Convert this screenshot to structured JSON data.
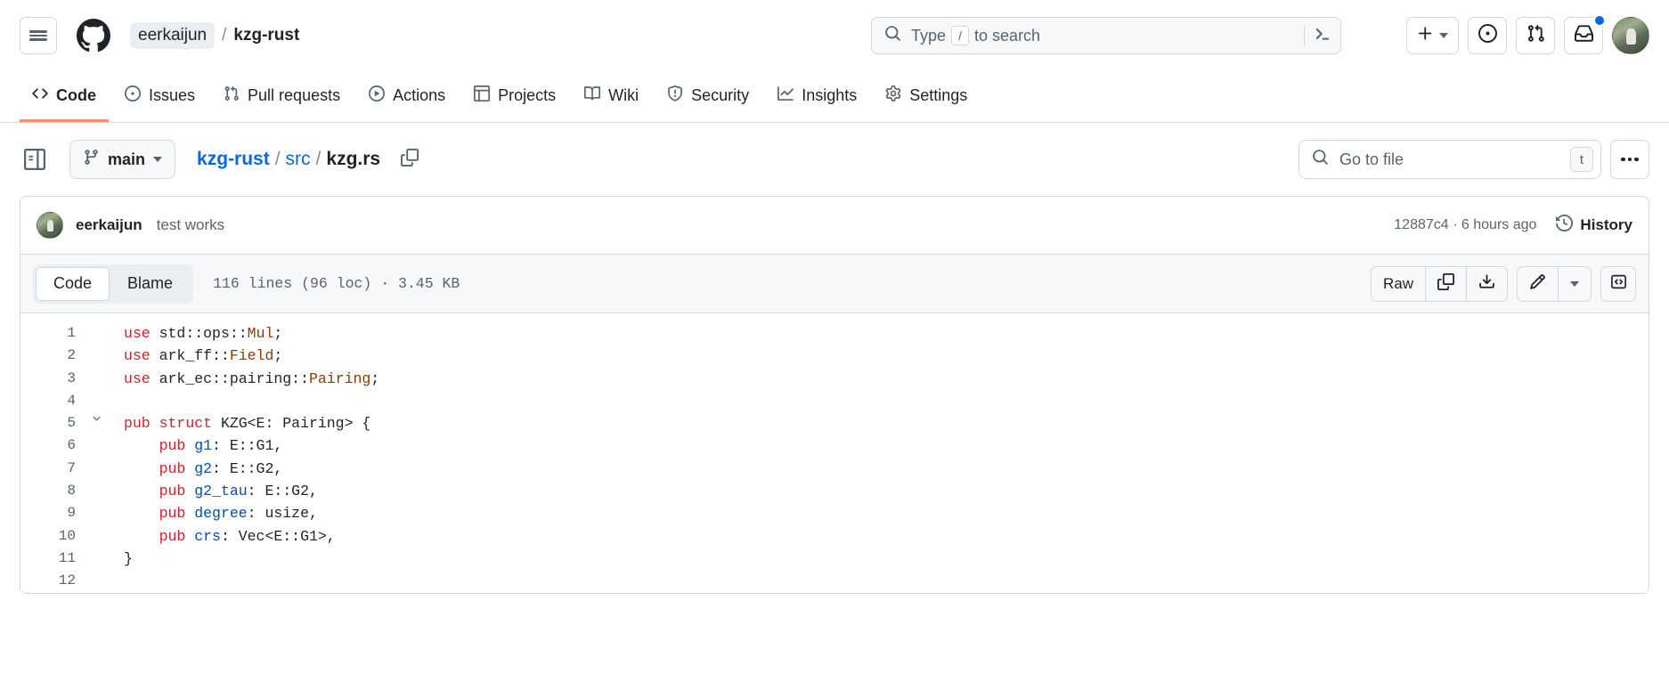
{
  "header": {
    "hamburger_label": "Open global navigation menu",
    "logo_name": "github-logo",
    "owner": "eerkaijun",
    "separator": "/",
    "repo": "kzg-rust",
    "search_placeholder": "Type",
    "search_key": "/",
    "search_suffix": "to search",
    "terminal_icon": "command-palette-icon",
    "create_new": "+",
    "icons": {
      "plus": "plus-icon",
      "issues": "issue-opened-icon",
      "pull_requests": "git-pull-request-icon",
      "inbox": "inbox-icon",
      "avatar": "user-avatar"
    },
    "notification_badge": true
  },
  "repo_nav": {
    "tabs": [
      {
        "label": "Code",
        "icon": "code-icon",
        "active": true
      },
      {
        "label": "Issues",
        "icon": "issue-opened-icon",
        "active": false
      },
      {
        "label": "Pull requests",
        "icon": "git-pull-request-icon",
        "active": false
      },
      {
        "label": "Actions",
        "icon": "play-icon",
        "active": false
      },
      {
        "label": "Projects",
        "icon": "table-icon",
        "active": false
      },
      {
        "label": "Wiki",
        "icon": "book-icon",
        "active": false
      },
      {
        "label": "Security",
        "icon": "shield-icon",
        "active": false
      },
      {
        "label": "Insights",
        "icon": "graph-icon",
        "active": false
      },
      {
        "label": "Settings",
        "icon": "gear-icon",
        "active": false
      }
    ]
  },
  "file_nav": {
    "sidebar_toggle_icon": "sidebar-expand-icon",
    "branch": "main",
    "branch_icon": "git-branch-icon",
    "path": {
      "repo": "kzg-rust",
      "folder": "src",
      "file": "kzg.rs",
      "separator": "/"
    },
    "copy_path_icon": "copy-icon",
    "go_to_file_placeholder": "Go to file",
    "go_to_file_key": "t",
    "search_icon": "search-icon",
    "kebab_icon": "kebab-horizontal-icon"
  },
  "commit": {
    "author": "eerkaijun",
    "message": "test works",
    "sha": "12887c4",
    "dot": "·",
    "relative_time": "6 hours ago",
    "history_label": "History",
    "history_icon": "history-icon"
  },
  "file_header": {
    "tabs": [
      {
        "label": "Code",
        "active": true
      },
      {
        "label": "Blame",
        "active": false
      }
    ],
    "stats": "116 lines (96 loc) · 3.45 KB",
    "raw_label": "Raw",
    "copy_icon": "copy-icon",
    "download_icon": "download-icon",
    "edit_icon": "pencil-icon",
    "edit_caret_icon": "chevron-down-icon",
    "symbols_icon": "code-symbols-icon"
  },
  "code": {
    "language": "rust",
    "lines": [
      {
        "n": "1",
        "fold": false,
        "tokens": [
          {
            "t": "use",
            "c": "k"
          },
          {
            "t": " std",
            "c": "p"
          },
          {
            "t": "::",
            "c": "p"
          },
          {
            "t": "ops",
            "c": "p"
          },
          {
            "t": "::",
            "c": "p"
          },
          {
            "t": "Mul",
            "c": "ty"
          },
          {
            "t": ";",
            "c": "p"
          }
        ]
      },
      {
        "n": "2",
        "fold": false,
        "tokens": [
          {
            "t": "use",
            "c": "k"
          },
          {
            "t": " ark_ff",
            "c": "p"
          },
          {
            "t": "::",
            "c": "p"
          },
          {
            "t": "Field",
            "c": "ty"
          },
          {
            "t": ";",
            "c": "p"
          }
        ]
      },
      {
        "n": "3",
        "fold": false,
        "tokens": [
          {
            "t": "use",
            "c": "k"
          },
          {
            "t": " ark_ec",
            "c": "p"
          },
          {
            "t": "::",
            "c": "p"
          },
          {
            "t": "pairing",
            "c": "p"
          },
          {
            "t": "::",
            "c": "p"
          },
          {
            "t": "Pairing",
            "c": "ty"
          },
          {
            "t": ";",
            "c": "p"
          }
        ]
      },
      {
        "n": "4",
        "fold": false,
        "tokens": []
      },
      {
        "n": "5",
        "fold": true,
        "tokens": [
          {
            "t": "pub",
            "c": "k"
          },
          {
            "t": " ",
            "c": "p"
          },
          {
            "t": "struct",
            "c": "k"
          },
          {
            "t": " KZG<E: Pairing> {",
            "c": "p"
          }
        ]
      },
      {
        "n": "6",
        "fold": false,
        "tokens": [
          {
            "t": "    ",
            "c": "p"
          },
          {
            "t": "pub",
            "c": "k"
          },
          {
            "t": " ",
            "c": "p"
          },
          {
            "t": "g1",
            "c": "fn"
          },
          {
            "t": ": E::G1,",
            "c": "p"
          }
        ]
      },
      {
        "n": "7",
        "fold": false,
        "tokens": [
          {
            "t": "    ",
            "c": "p"
          },
          {
            "t": "pub",
            "c": "k"
          },
          {
            "t": " ",
            "c": "p"
          },
          {
            "t": "g2",
            "c": "fn"
          },
          {
            "t": ": E::G2,",
            "c": "p"
          }
        ]
      },
      {
        "n": "8",
        "fold": false,
        "tokens": [
          {
            "t": "    ",
            "c": "p"
          },
          {
            "t": "pub",
            "c": "k"
          },
          {
            "t": " ",
            "c": "p"
          },
          {
            "t": "g2_tau",
            "c": "fn"
          },
          {
            "t": ": E::G2,",
            "c": "p"
          }
        ]
      },
      {
        "n": "9",
        "fold": false,
        "tokens": [
          {
            "t": "    ",
            "c": "p"
          },
          {
            "t": "pub",
            "c": "k"
          },
          {
            "t": " ",
            "c": "p"
          },
          {
            "t": "degree",
            "c": "fn"
          },
          {
            "t": ": usize,",
            "c": "p"
          }
        ]
      },
      {
        "n": "10",
        "fold": false,
        "tokens": [
          {
            "t": "    ",
            "c": "p"
          },
          {
            "t": "pub",
            "c": "k"
          },
          {
            "t": " ",
            "c": "p"
          },
          {
            "t": "crs",
            "c": "fn"
          },
          {
            "t": ": Vec<E::G1>,",
            "c": "p"
          }
        ]
      },
      {
        "n": "11",
        "fold": false,
        "tokens": [
          {
            "t": "}",
            "c": "p"
          }
        ]
      },
      {
        "n": "12",
        "fold": false,
        "tokens": []
      }
    ]
  },
  "colors": {
    "accent": "#0969da",
    "active_tab_underline": "#fd8c73",
    "keyword": "#cf222e",
    "type": "#953800",
    "field": "#0550ae",
    "border": "#d1d9e0",
    "muted_text": "#59636e",
    "surface": "#f6f8fa"
  }
}
